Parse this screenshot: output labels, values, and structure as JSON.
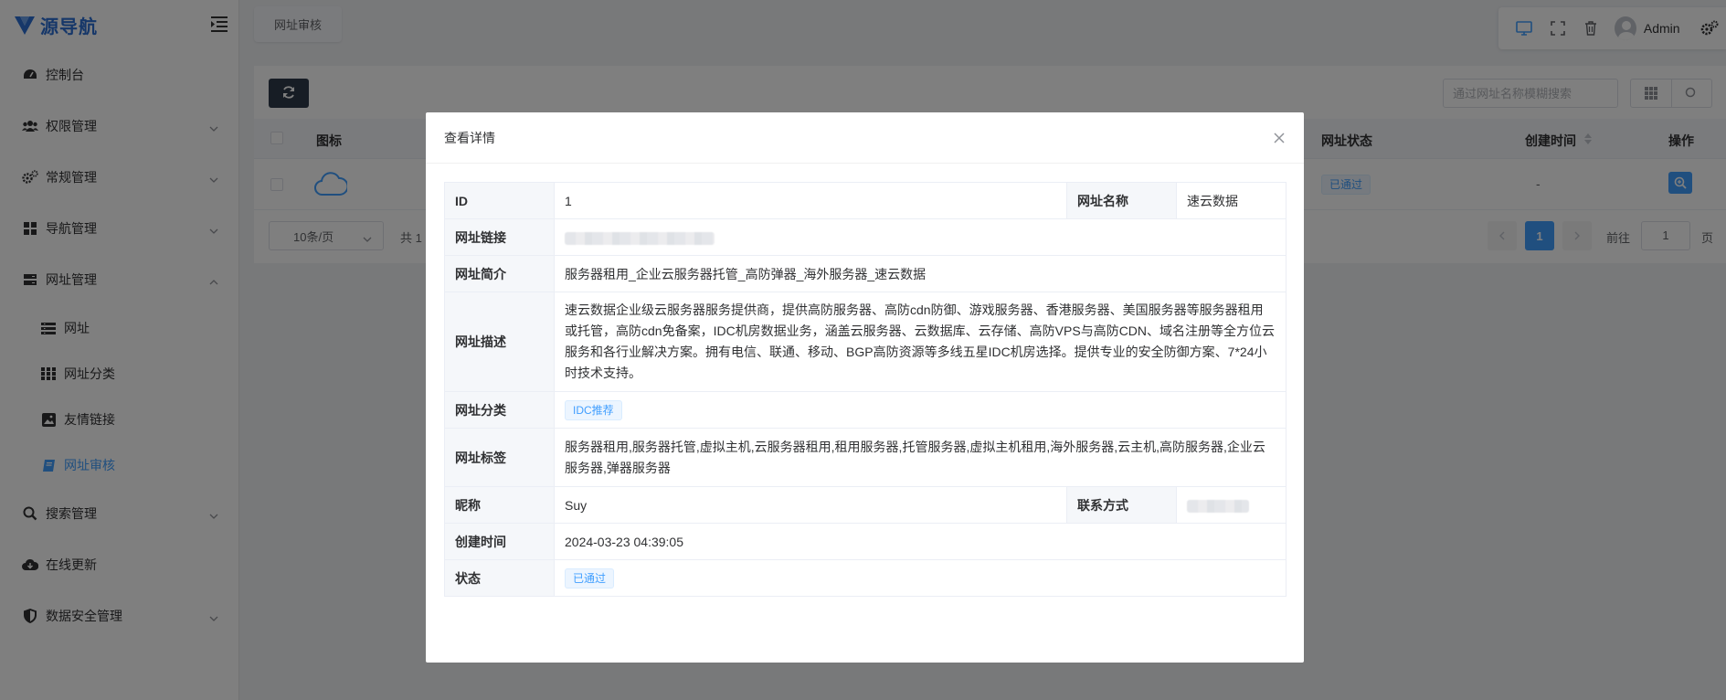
{
  "app": {
    "logo_text": "源导航",
    "brand_color": "#2d6fd3",
    "accent_color": "#409eff"
  },
  "sidebar": {
    "items": [
      {
        "label": "控制台",
        "icon": "dashboard-icon"
      },
      {
        "label": "权限管理",
        "icon": "users-icon"
      },
      {
        "label": "常规管理",
        "icon": "cogs-icon"
      },
      {
        "label": "导航管理",
        "icon": "grid-icon"
      },
      {
        "label": "网址管理",
        "icon": "server-icon"
      },
      {
        "label": "搜索管理",
        "icon": "search-icon"
      },
      {
        "label": "在线更新",
        "icon": "cloud-download-icon"
      },
      {
        "label": "数据安全管理",
        "icon": "shield-icon"
      }
    ],
    "submenu": [
      {
        "label": "网址",
        "icon": "list-icon"
      },
      {
        "label": "网址分类",
        "icon": "th-icon"
      },
      {
        "label": "友情链接",
        "icon": "image-icon"
      },
      {
        "label": "网址审核",
        "icon": "book-icon",
        "active": true
      }
    ]
  },
  "header": {
    "tab_label": "网址审核",
    "user_name": "Admin"
  },
  "main": {
    "search_placeholder": "通过网址名称模糊搜索",
    "columns": {
      "icon": "图标",
      "status": "网址状态",
      "created": "创建时间",
      "actions": "操作"
    },
    "row": {
      "status": "已通过",
      "created": "-"
    },
    "pager": {
      "page_size": "10条/页",
      "total": "共 1",
      "current_page": "1",
      "goto_label": "前往",
      "goto_value": "1",
      "page_suffix": "页"
    }
  },
  "dialog": {
    "title": "查看详情",
    "fields": {
      "id_label": "ID",
      "id_value": "1",
      "name_label": "网址名称",
      "name_value": "速云数据",
      "link_label": "网址链接",
      "intro_label": "网址简介",
      "intro_value": "服务器租用_企业云服务器托管_高防弹器_海外服务器_速云数据",
      "desc_label": "网址描述",
      "desc_value": "速云数据企业级云服务器服务提供商，提供高防服务器、高防cdn防御、游戏服务器、香港服务器、美国服务器等服务器租用或托管，高防cdn免备案，IDC机房数据业务，涵盖云服务器、云数据库、云存储、高防VPS与高防CDN、域名注册等全方位云服务和各行业解决方案。拥有电信、联通、移动、BGP高防资源等多线五星IDC机房选择。提供专业的安全防御方案、7*24小时技术支持。",
      "category_label": "网址分类",
      "category_value": "IDC推荐",
      "tags_label": "网址标签",
      "tags_value": "服务器租用,服务器托管,虚拟主机,云服务器租用,租用服务器,托管服务器,虚拟主机租用,海外服务器,云主机,高防服务器,企业云服务器,弹器服务器",
      "nickname_label": "昵称",
      "nickname_value": "Suy",
      "contact_label": "联系方式",
      "created_label": "创建时间",
      "created_value": "2024-03-23 04:39:05",
      "status_label": "状态",
      "status_value": "已通过"
    }
  }
}
